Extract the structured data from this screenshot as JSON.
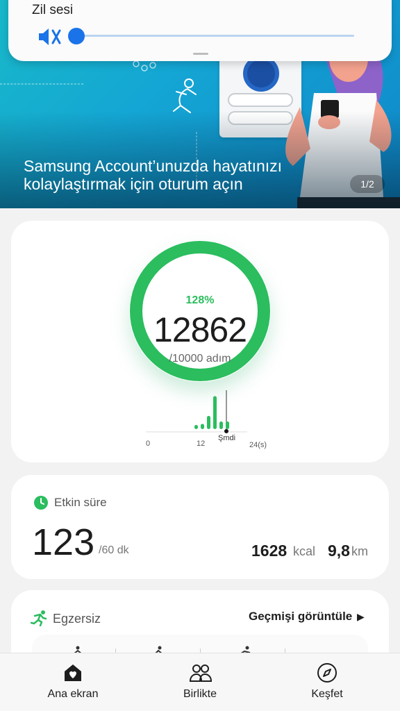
{
  "volume_panel": {
    "label": "Zil sesi",
    "level": 0,
    "muted": true,
    "icon": "volume-mute-icon"
  },
  "banner": {
    "title": "Samsung Account’unuzda hayatınızı kolaylaştırmak için oturum açın",
    "page_indicator": "1/2",
    "colors": {
      "start": "#18b9c9",
      "end": "#0f86c9"
    }
  },
  "steps": {
    "percent": "128%",
    "count": "12862",
    "goal": "/10000 adım",
    "progress_fraction": 1.0,
    "accent": "#2bbd5e",
    "chart": {
      "axis_labels": [
        "0",
        "12",
        "24(s)"
      ],
      "now_label": "Şmdi",
      "bars": [
        0.12,
        0.15,
        0.38,
        0.95,
        0.22,
        0.22
      ]
    }
  },
  "active_time": {
    "title": "Etkin süre",
    "value": "123",
    "unit": "/60 dk",
    "kcal_value": "1628",
    "kcal_unit": "kcal",
    "km_value": "9,8",
    "km_unit": "km"
  },
  "exercise": {
    "title": "Egzersiz",
    "history_link": "Geçmişi görüntüle",
    "arrow": "▶"
  },
  "bottom_nav": {
    "items": [
      {
        "label": "Ana ekran",
        "icon": "home-heart-icon",
        "selected": true
      },
      {
        "label": "Birlikte",
        "icon": "people-icon",
        "selected": false
      },
      {
        "label": "Keşfet",
        "icon": "compass-icon",
        "selected": false
      }
    ]
  }
}
